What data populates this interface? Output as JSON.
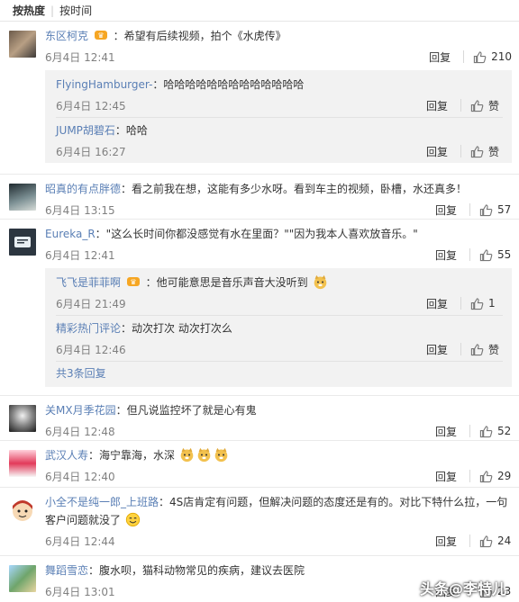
{
  "sort_tabs": {
    "hot": "按热度",
    "time": "按时间"
  },
  "reply_label": "回复",
  "like_label": "赞",
  "comments": [
    {
      "user": "东区柯克",
      "text": "：希望有后续视频，拍个《水虎传》",
      "time": "6月4日 12:41",
      "likes": "210",
      "replies": [
        {
          "user": "FlyingHamburger-",
          "text": "：哈哈哈哈哈哈哈哈哈哈哈哈哈",
          "time": "6月4日 12:45"
        },
        {
          "user": "JUMP胡碧石",
          "text": "：哈哈",
          "time": "6月4日 16:27"
        }
      ]
    },
    {
      "user": "昭真的有点胖德",
      "text": "：看之前我在想，这能有多少水呀。看到车主的视频，卧槽，水还真多！",
      "time": "6月4日 13:15",
      "likes": "57"
    },
    {
      "user": "Eureka_R",
      "text": "：\"这么长时间你都没感觉有水在里面？\"\"因为我本人喜欢放音乐。\"",
      "time": "6月4日 12:41",
      "likes": "55",
      "replies": [
        {
          "user": "飞飞是菲菲啊",
          "text": "：他可能意思是音乐声音大没听到",
          "time": "6月4日 21:49",
          "likes": "1"
        },
        {
          "user": "精彩热门评论",
          "text": "：动次打次 动次打次么",
          "time": "6月4日 12:46"
        }
      ],
      "more": "共3条回复"
    },
    {
      "user": "关MX月季花园",
      "text": "：但凡说监控坏了就是心有鬼",
      "time": "6月4日 12:48",
      "likes": "52"
    },
    {
      "user": "武汉人寿",
      "text": "：海宁靠海，水深",
      "time": "6月4日 12:40",
      "likes": "29"
    },
    {
      "user": "小全不是纯一郎_上班路",
      "text": "：4S店肯定有问题，但解决问题的态度还是有的。对比下特什么拉，一句",
      "text2": "客户问题就没了",
      "time": "6月4日 12:44",
      "likes": "24"
    },
    {
      "user": "舞蹈雪恋",
      "text": "：腹水呗，猫科动物常见的疾病，建议去医院",
      "time": "6月4日 13:01",
      "likes": "23"
    }
  ],
  "watermark": "头条@李特儿",
  "colors": {
    "link": "#5a7fb5",
    "reply_bg": "#f2f2f2",
    "timestamp": "#808080"
  }
}
